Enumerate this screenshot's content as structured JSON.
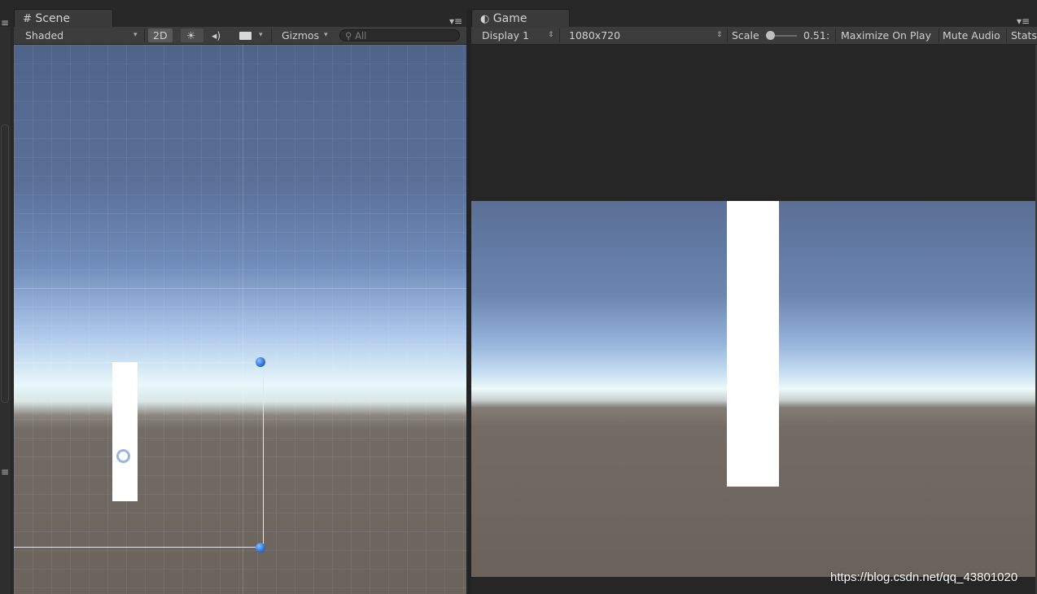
{
  "scene_panel": {
    "tab_title": "Scene",
    "shading_mode": "Shaded",
    "mode_2d": "2D",
    "gizmos_label": "Gizmos",
    "search_placeholder": "All"
  },
  "game_panel": {
    "tab_title": "Game",
    "display": "Display 1",
    "resolution": "1080x720",
    "scale_label": "Scale",
    "scale_value": "0.51",
    "maximize_on_play": "Maximize On Play",
    "mute_audio": "Mute Audio",
    "stats": "Stats"
  },
  "watermark": "https://blog.csdn.net/qq_43801020",
  "colors": {
    "editor_bg": "#282828",
    "toolbar_bg": "#3c3c3c",
    "handle_blue": "#2a6fd6"
  }
}
